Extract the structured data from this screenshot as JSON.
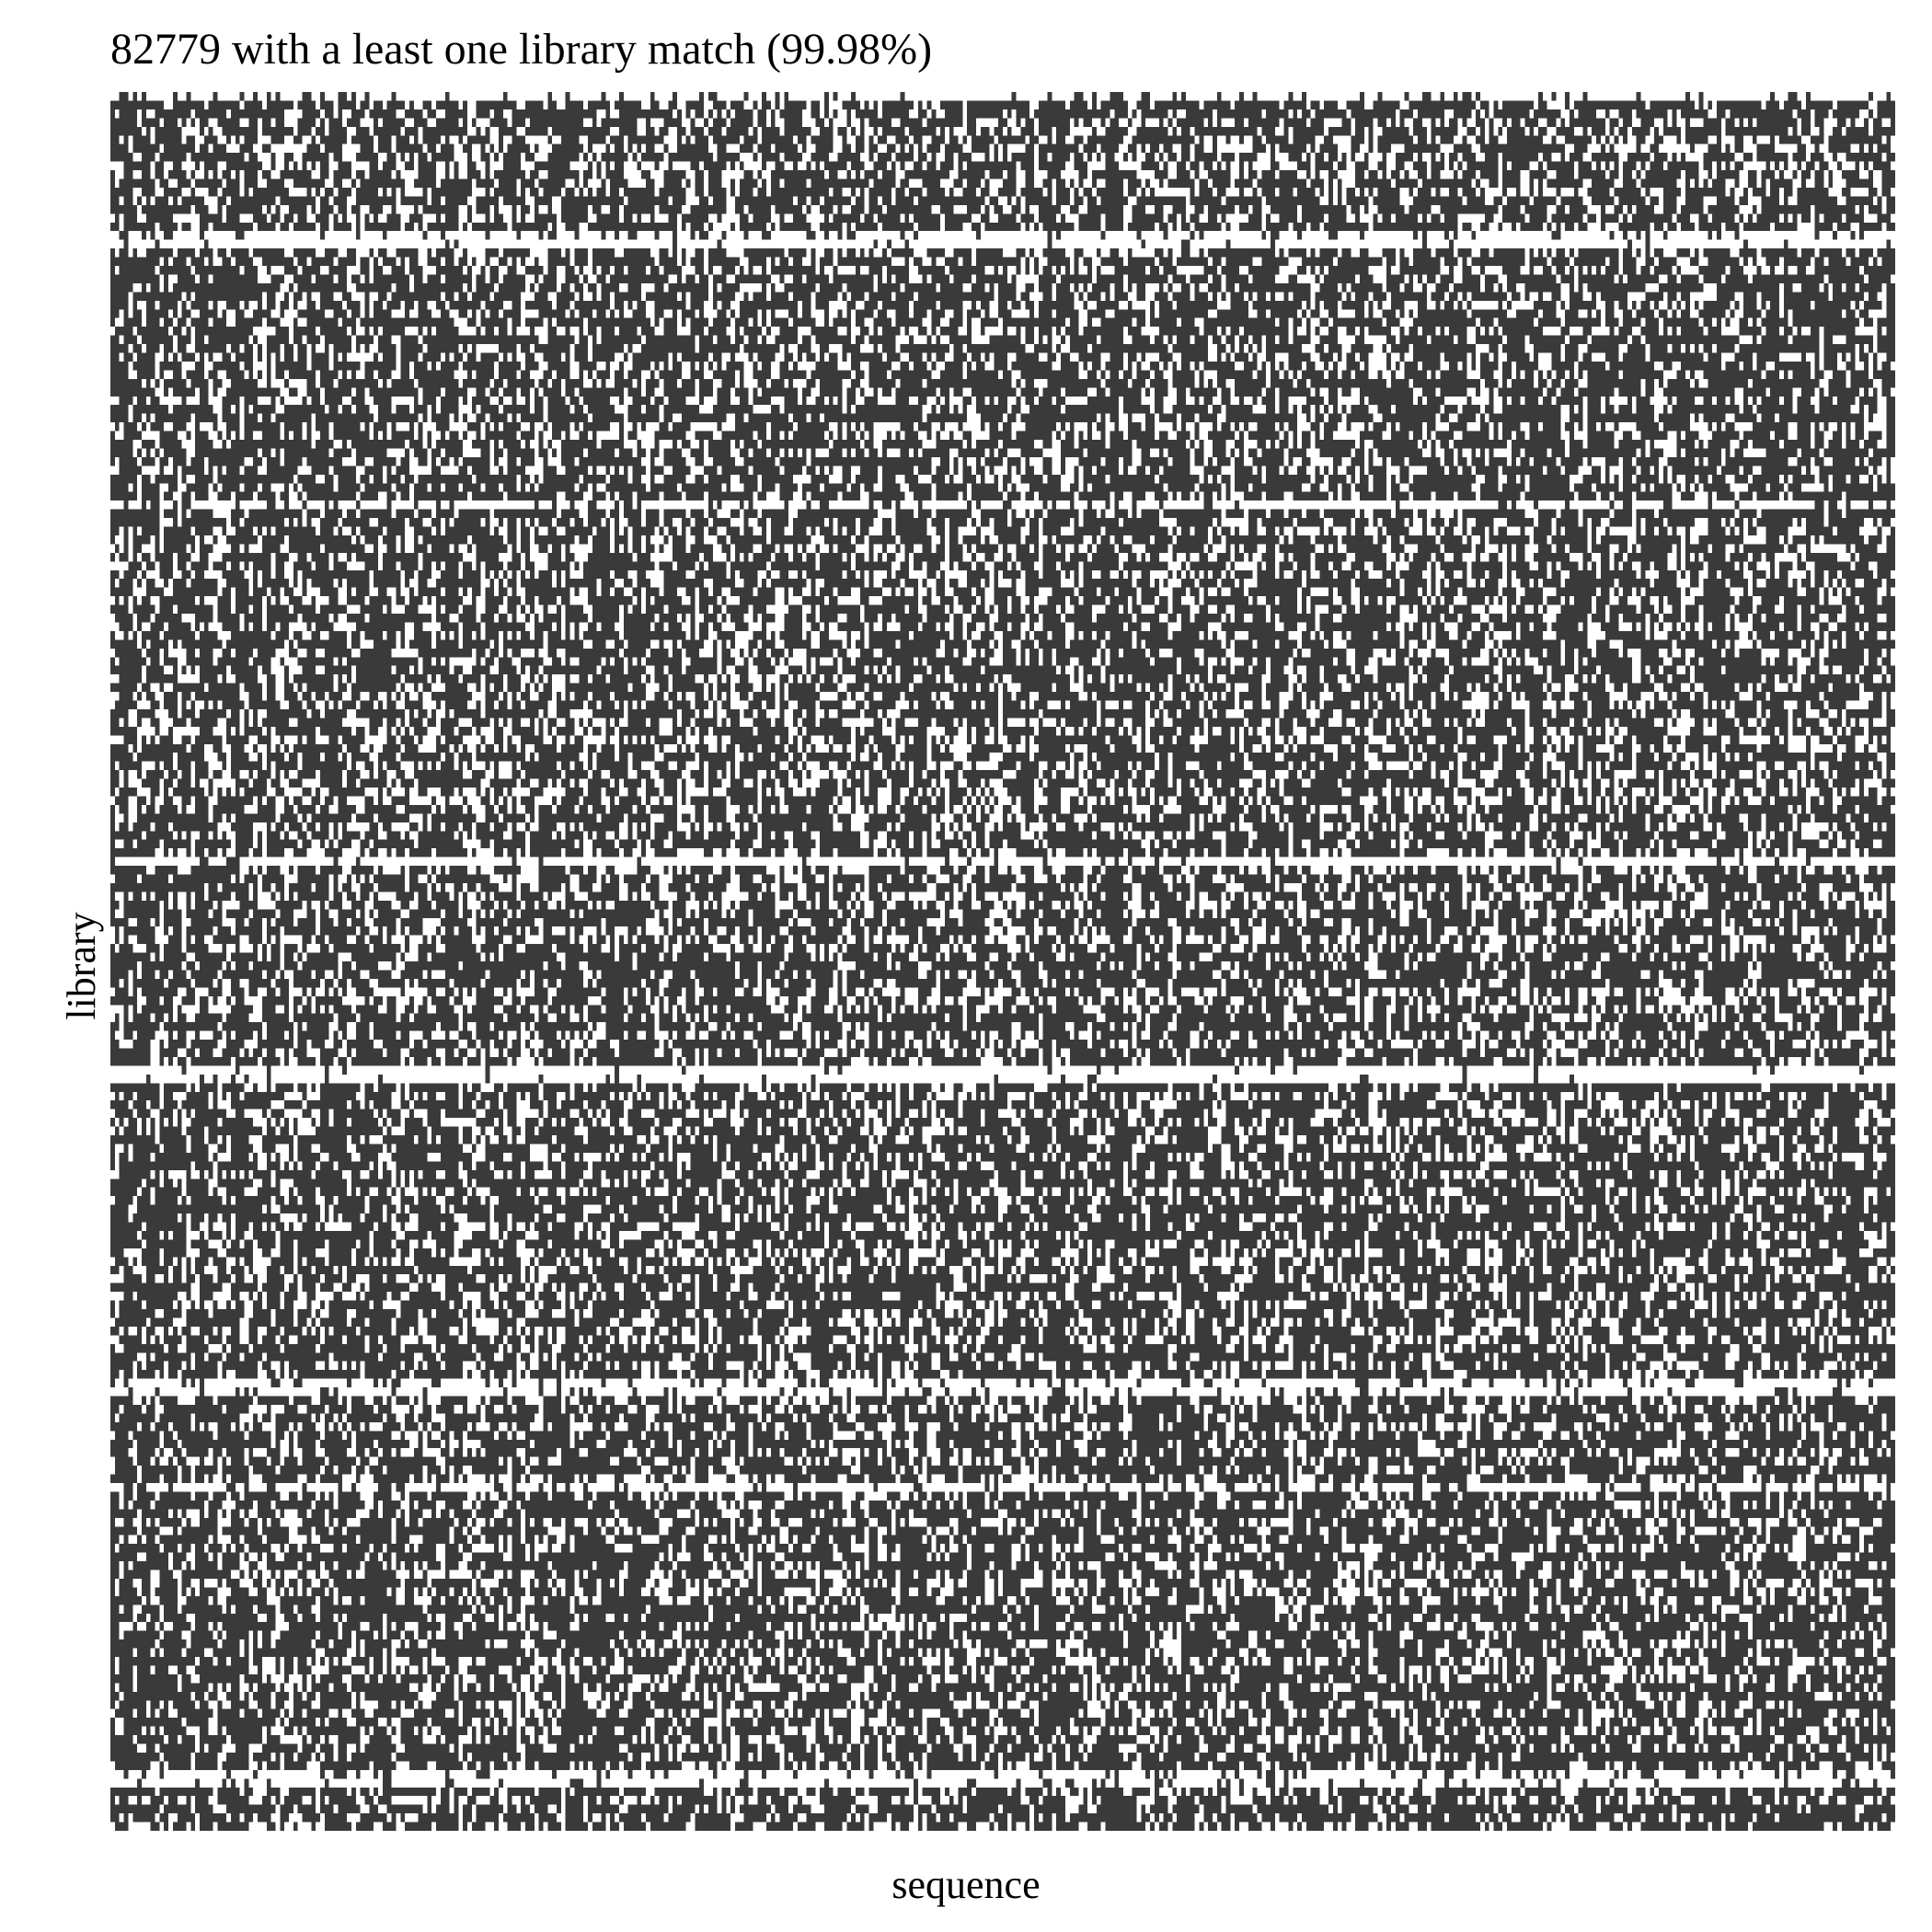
{
  "chart_data": {
    "type": "heatmap",
    "title": "82779  with a least one library match (99.98%)",
    "xlabel": "sequence",
    "ylabel": "library",
    "n_rows": 200,
    "n_cols": 400,
    "density": 0.32,
    "row_seeds": [
      64,
      23,
      109,
      128,
      91,
      148,
      227,
      164,
      250,
      225,
      158,
      221,
      31,
      122,
      157,
      46,
      88,
      239,
      186,
      69,
      177,
      50,
      71,
      47,
      238,
      209,
      1,
      188,
      37,
      49,
      174,
      134,
      106,
      31,
      8,
      215,
      95,
      34,
      246,
      168,
      87,
      68,
      134,
      194,
      69,
      57,
      51,
      12,
      32,
      93,
      248,
      28,
      200,
      172,
      146,
      194,
      105,
      168,
      214,
      158,
      56,
      217,
      133,
      35,
      192,
      172,
      56,
      142,
      128,
      208,
      178,
      67,
      248,
      135,
      228,
      152,
      2,
      240,
      153,
      217,
      254,
      255,
      187,
      42,
      159,
      126,
      28,
      174,
      250,
      250,
      148,
      155,
      247,
      233,
      104,
      31,
      178,
      231,
      189,
      79,
      18,
      49,
      20,
      244,
      236,
      254,
      69,
      9,
      246,
      171,
      136,
      88,
      247,
      212,
      35,
      226,
      79,
      213,
      220,
      172,
      96,
      78,
      146,
      81,
      179,
      25,
      227,
      100,
      52,
      10,
      105,
      29,
      122,
      201,
      214,
      159,
      204,
      13,
      179,
      131,
      92,
      208,
      222,
      187,
      37,
      45,
      174,
      49,
      32,
      100,
      157,
      216,
      15,
      215,
      84,
      29,
      211,
      121,
      9,
      146,
      57,
      87,
      125,
      20,
      235,
      75,
      69,
      193,
      66,
      55,
      185,
      243,
      150,
      171,
      6,
      31,
      164,
      15,
      127,
      60,
      219,
      202,
      74,
      108,
      18,
      146,
      184,
      62,
      177,
      81,
      72,
      20,
      56,
      60,
      156,
      59,
      223,
      13,
      35,
      134
    ],
    "col_seeds": [
      246,
      48,
      126,
      21,
      46,
      252,
      130,
      23,
      210,
      114,
      131,
      250,
      4,
      62,
      24,
      229,
      88,
      209,
      212,
      84,
      57,
      23,
      161,
      109,
      207,
      116,
      73,
      24,
      11,
      110,
      51,
      121,
      194,
      244,
      248,
      145,
      104,
      165,
      232,
      96,
      214,
      230,
      153,
      25,
      9,
      80,
      245,
      94,
      217,
      34,
      66,
      51,
      26,
      181,
      253,
      58,
      122,
      125,
      160,
      58,
      18,
      87,
      178,
      133,
      246,
      161,
      241,
      225,
      193,
      147,
      114,
      185,
      137,
      63,
      222,
      33,
      7,
      90,
      252,
      138,
      221,
      234,
      77,
      229,
      22,
      206,
      98,
      154,
      108,
      219,
      40,
      230,
      252,
      204,
      249,
      223,
      26,
      113,
      51,
      5,
      124,
      172,
      6,
      62,
      124,
      82,
      244,
      90,
      35,
      179,
      15,
      22,
      21,
      39,
      148,
      193,
      45,
      20,
      234,
      198,
      148,
      112,
      211,
      150,
      8,
      180,
      5,
      152,
      118,
      233,
      169,
      130,
      104,
      253,
      159,
      53,
      47,
      22,
      254,
      255,
      224,
      103,
      11,
      196,
      104,
      238,
      135,
      214,
      44,
      171,
      223,
      59,
      249,
      33,
      78,
      164,
      178,
      111,
      215,
      118,
      206,
      64,
      170,
      74,
      105,
      125,
      203,
      247,
      106,
      230,
      22,
      126,
      235,
      98,
      44,
      184,
      82,
      5,
      208,
      231,
      165,
      51,
      139,
      138,
      184,
      232,
      48,
      132,
      153,
      154,
      126,
      235,
      116,
      99,
      15,
      253,
      130,
      227,
      81,
      230,
      21,
      244,
      190,
      143,
      206,
      68,
      63,
      240,
      201,
      27,
      114,
      128,
      18,
      13,
      162,
      119,
      36,
      253,
      143,
      72,
      133,
      89,
      64,
      4,
      42,
      26,
      28,
      210,
      86,
      227,
      151,
      44,
      206,
      148,
      51,
      21,
      1,
      197,
      193,
      128,
      45,
      21,
      206,
      146,
      80,
      35,
      59,
      106,
      10,
      191,
      34,
      213,
      58,
      137,
      196,
      94,
      137,
      13,
      221,
      40,
      52,
      252,
      75,
      99,
      247,
      0,
      216,
      138,
      38,
      79,
      11,
      126,
      237,
      59,
      103,
      192,
      195,
      177,
      233,
      66,
      91,
      114,
      246,
      235,
      112,
      39,
      163,
      98,
      9,
      193,
      193,
      194,
      76,
      82,
      27,
      227,
      121,
      196,
      51,
      135,
      216,
      7,
      191,
      24,
      112,
      166,
      150,
      120,
      230,
      111,
      213,
      250,
      120,
      59,
      28,
      45,
      45,
      184,
      212,
      21,
      187,
      97,
      252,
      106,
      7,
      154,
      167,
      3,
      128,
      128,
      123,
      114,
      95,
      174,
      3,
      245,
      59,
      201,
      252,
      113,
      156,
      227,
      106,
      28,
      37,
      41,
      192,
      177,
      147,
      201,
      146,
      176,
      254,
      1,
      113,
      161,
      221,
      165,
      23,
      79,
      9,
      167,
      138,
      135,
      99,
      60,
      124,
      237,
      97,
      144,
      158,
      119,
      17,
      11,
      120,
      126,
      189,
      103,
      211,
      130,
      7,
      239,
      30,
      176,
      163,
      184,
      21,
      28,
      67,
      19,
      226,
      79,
      114,
      202,
      37,
      152,
      56,
      233,
      105,
      89
    ],
    "sparse_rows": [
      0,
      16,
      17,
      47,
      88,
      112,
      113,
      148,
      149,
      160,
      193,
      194
    ],
    "dense_cols": [
      0,
      3,
      8,
      20,
      28,
      35,
      48,
      62,
      75,
      90,
      102,
      118,
      132,
      146,
      160,
      178,
      195,
      210,
      225,
      240,
      260,
      280,
      300,
      320,
      340,
      360,
      375,
      390,
      398
    ],
    "colors": {
      "dark": "#3a3a3a",
      "light": "#ffffff"
    }
  }
}
